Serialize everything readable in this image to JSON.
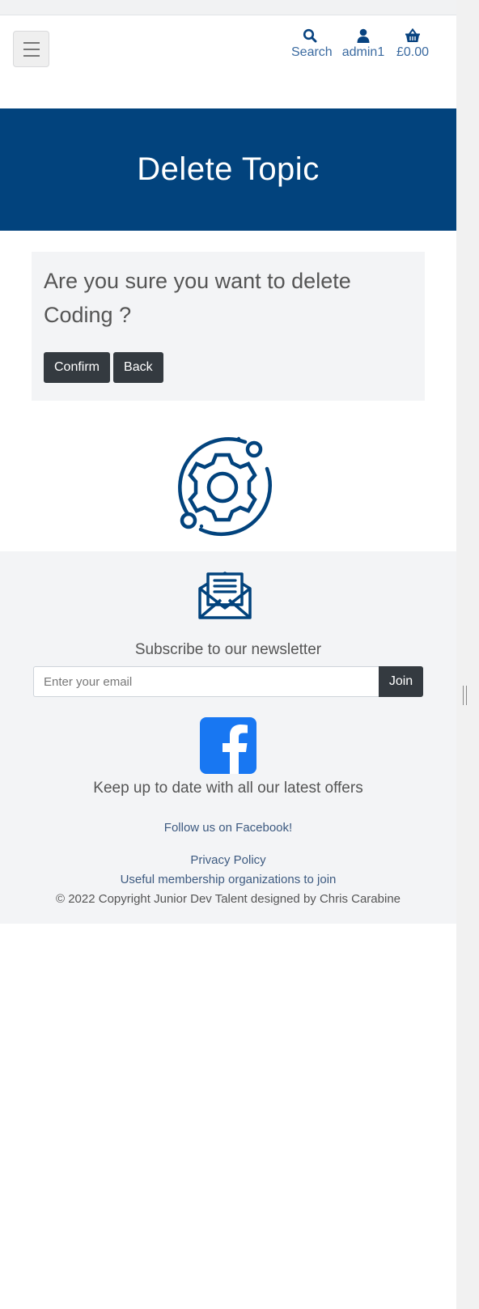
{
  "nav": {
    "search_label": "Search",
    "account_label": "admin1",
    "basket_label": "£0.00",
    "icons": {
      "menu": "hamburger-icon",
      "search": "search-icon",
      "account": "user-icon",
      "basket": "basket-icon"
    }
  },
  "hero": {
    "title": "Delete Topic"
  },
  "confirm": {
    "question": "Are you sure you want to delete Coding ?",
    "confirm_label": "Confirm",
    "back_label": "Back"
  },
  "footer": {
    "subscribe_text": "Subscribe to our newsletter",
    "email_placeholder": "Enter your email",
    "join_label": "Join",
    "offers_text": "Keep up to date with all our latest offers",
    "facebook_link": "Follow us on Facebook!",
    "privacy_link": "Privacy Policy",
    "membership_link": "Useful membership organizations to join",
    "copyright": "© 2022 Copyright Junior Dev Talent designed by Chris Carabine"
  },
  "colors": {
    "brand": "#02437d",
    "button": "#343a40",
    "footer_bg": "#f3f4f6",
    "facebook": "#1877f2"
  }
}
